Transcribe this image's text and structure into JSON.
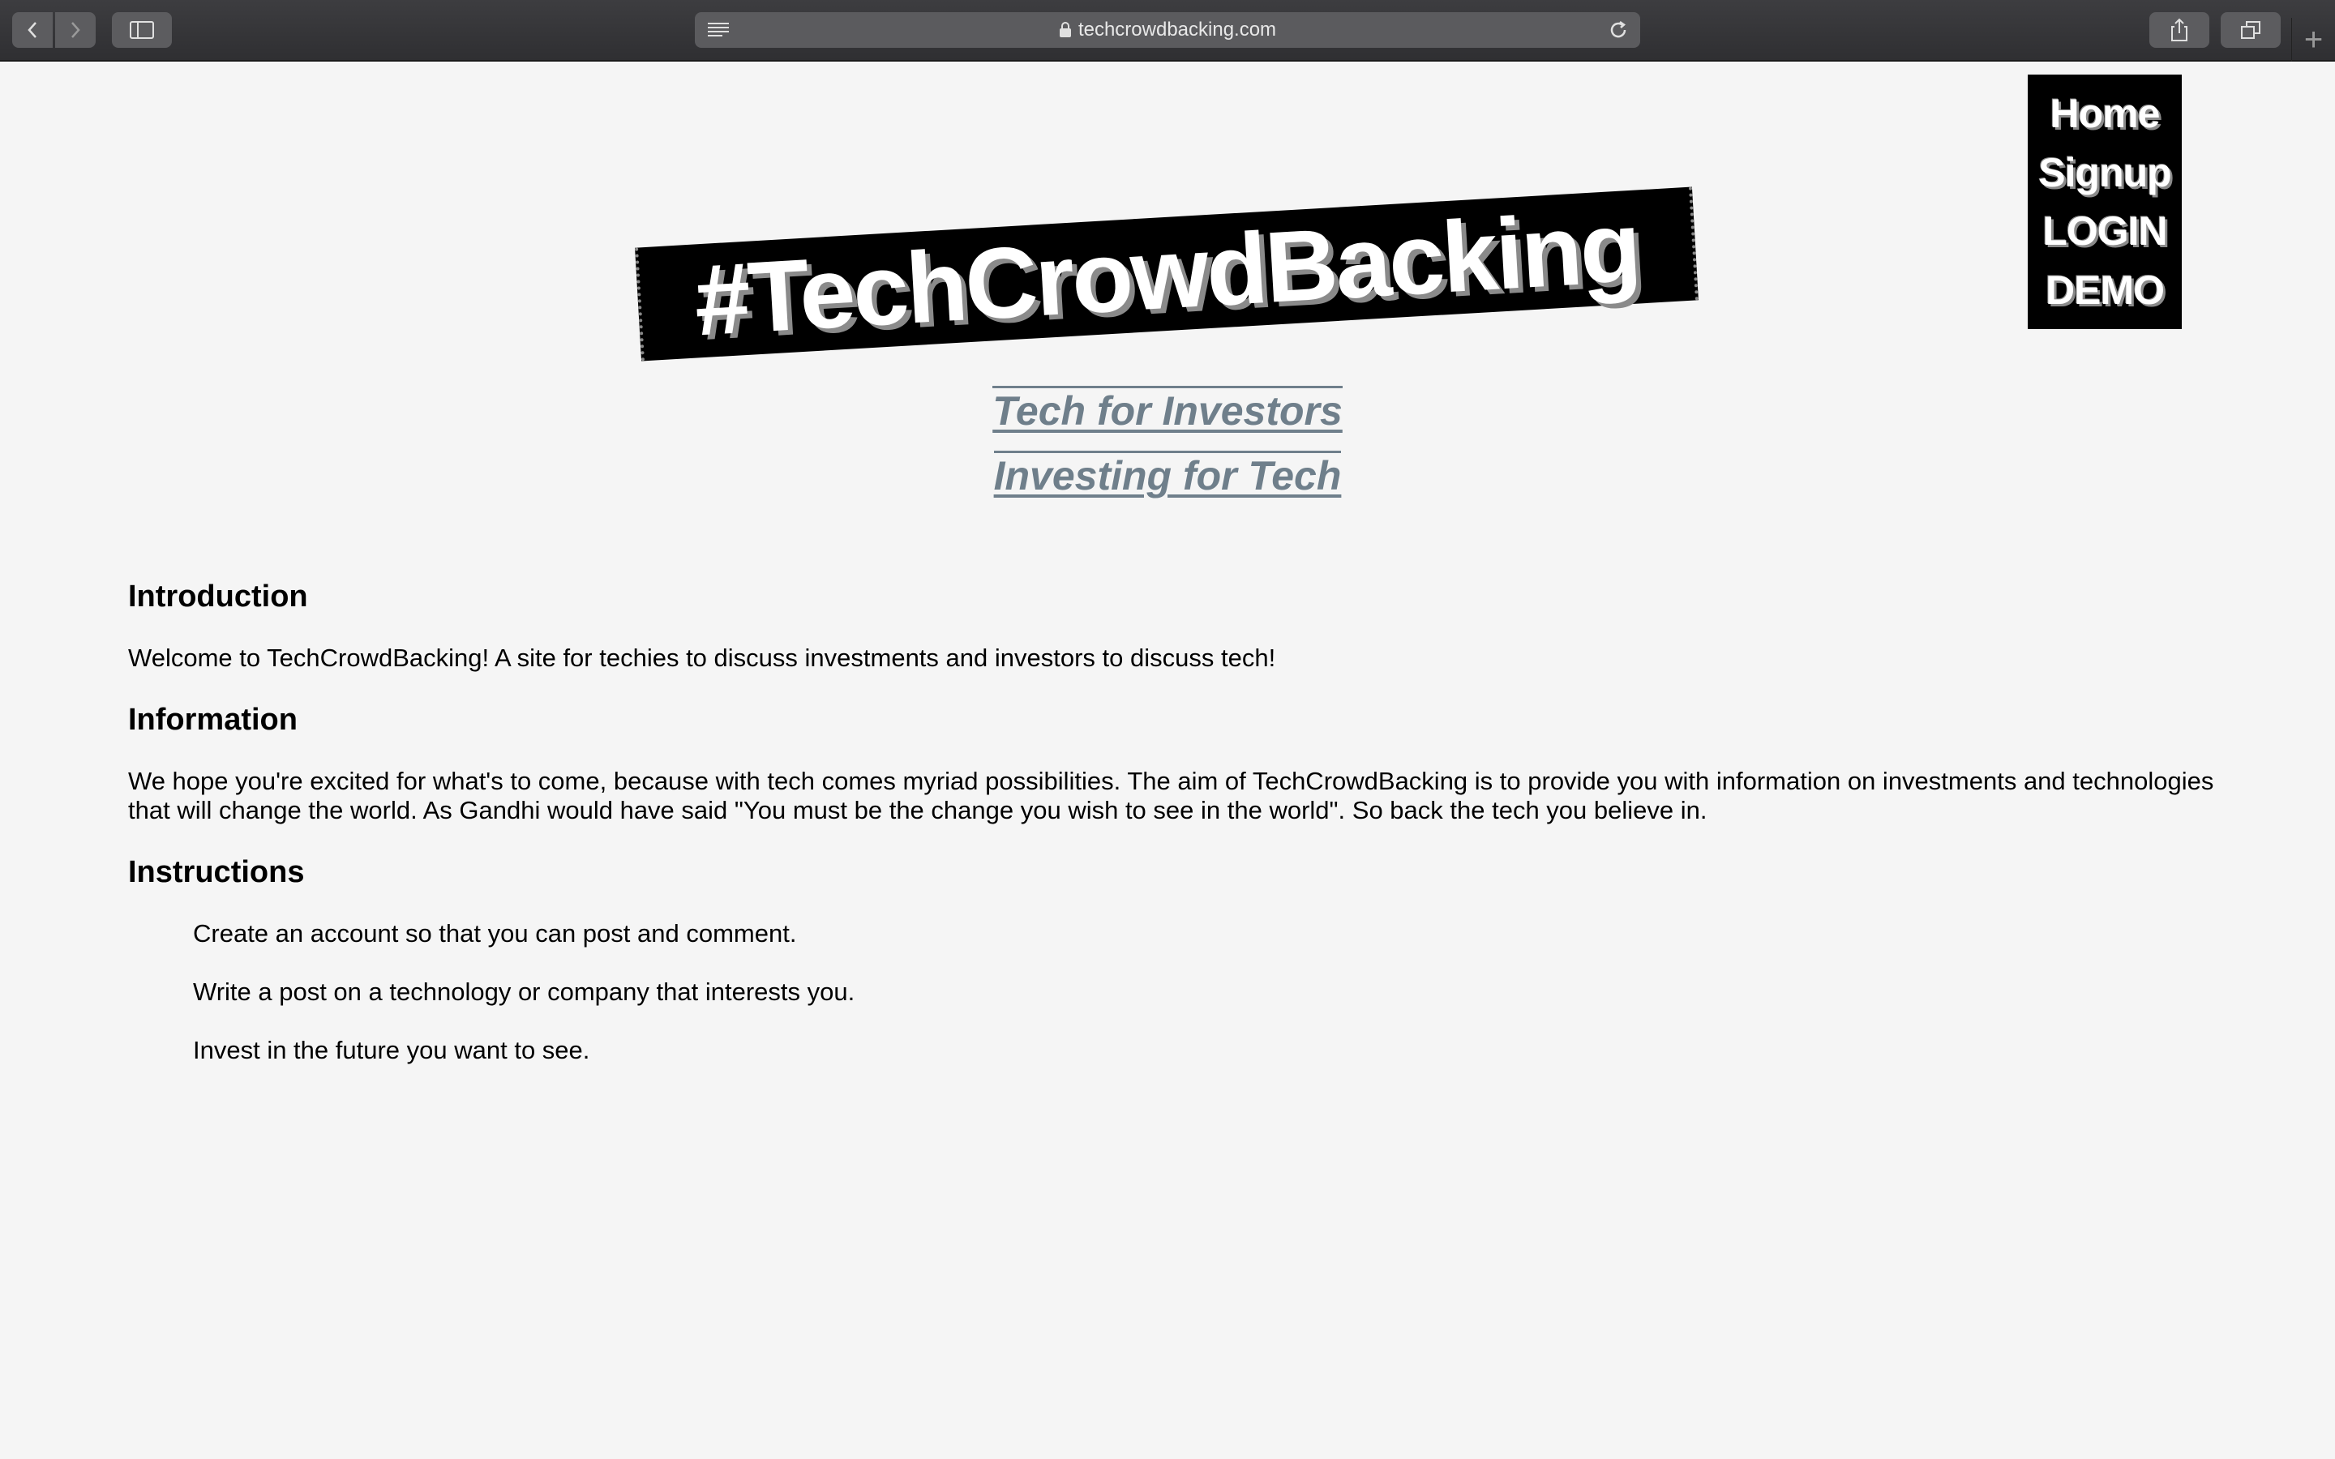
{
  "browser": {
    "url": "techcrowdbacking.com",
    "icons": [
      "back-icon",
      "forward-icon",
      "sidebar-icon",
      "reader-icon",
      "lock-icon",
      "reload-icon",
      "share-icon",
      "tabs-icon",
      "new-tab-icon"
    ],
    "new_tab_label": "+"
  },
  "menu": {
    "items": [
      "Home",
      "Signup",
      "LOGIN",
      "DEMO"
    ]
  },
  "banner": {
    "title": "#TechCrowdBacking"
  },
  "taglines": [
    "Tech for Investors",
    "Investing for Tech"
  ],
  "sections": {
    "intro": {
      "heading": "Introduction",
      "body": "Welcome to TechCrowdBacking! A site for techies to discuss investments and investors to discuss tech!"
    },
    "info": {
      "heading": "Information",
      "body": "We hope you're excited for what's to come, because with tech comes myriad possibilities. The aim of TechCrowdBacking is to provide you with information on investments and technologies that will change the world. As Gandhi would have said \"You must be the change you wish to see in the world\". So back the tech you believe in."
    },
    "instructions": {
      "heading": "Instructions",
      "items": [
        "Create an account so that you can post and comment.",
        "Write a post on a technology or company that interests you.",
        "Invest in the future you want to see."
      ]
    }
  },
  "colors": {
    "background": "#f5f5f5",
    "tagline": "#6f7f8b",
    "shadow": "#8a8a8a"
  }
}
